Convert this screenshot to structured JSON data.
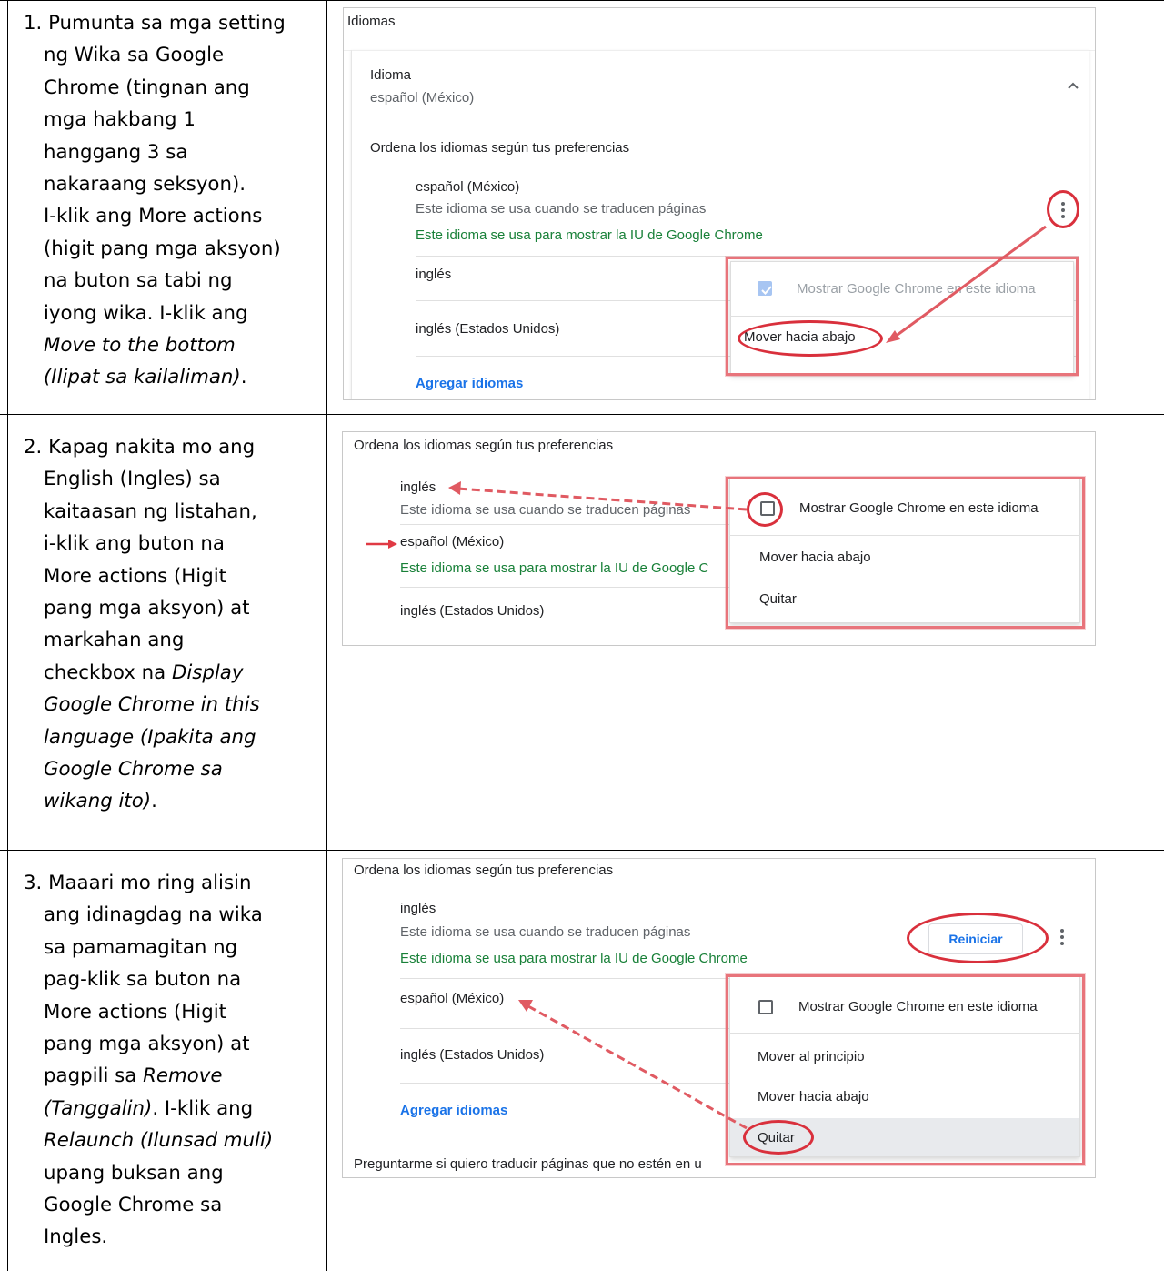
{
  "steps": [
    {
      "text_lines": [
        "1. Pumunta sa mga setting",
        "ng Wika sa Google",
        "Chrome (tingnan ang",
        "mga hakbang 1",
        "hanggang 3 sa",
        "nakaraang seksyon).",
        "I-klik ang More actions",
        "(higit pang mga aksyon)",
        "na buton sa tabi ng",
        "iyong wika. I-klik ang"
      ],
      "italic_lines": [
        "Move to the bottom",
        "(Ilipat sa kailaliman)"
      ],
      "tail": "."
    },
    {
      "text_lines": [
        "2. Kapag nakita mo ang",
        "English (Ingles) sa",
        "kaitaasan ng listahan,",
        "i-klik ang buton na",
        "More actions (Higit",
        "pang mga aksyon) at",
        "markahan ang",
        "checkbox na"
      ],
      "italic_lines": [
        "Display",
        "Google Chrome in this",
        "language (Ipakita ang",
        "Google Chrome sa",
        "wikang ito)"
      ],
      "tail": "."
    },
    {
      "text_lines": [
        "3. Maaari mo ring alisin",
        "ang idinagdag na wika",
        "sa pamamagitan ng",
        "pag-klik sa buton na",
        "More actions (Higit",
        "pang mga aksyon) at",
        "pagpili sa"
      ],
      "italic_a": "Remove",
      "italic_b": "(Tanggalin)",
      "mid": ". I-klik ang",
      "italic_c": "Relaunch (Ilunsad muli)",
      "end_lines": [
        "upang buksan ang",
        "Google Chrome sa",
        "Ingles."
      ]
    }
  ],
  "shot1": {
    "section_title": "Idiomas",
    "idioma_label": "Idioma",
    "idioma_value": "español (México)",
    "order_heading": "Ordena los idiomas según tus preferencias",
    "lang1": "español (México)",
    "lang1_note1": "Este idioma se usa cuando se traducen páginas",
    "lang1_note2": "Este idioma se usa para mostrar la IU de Google Chrome",
    "lang2": "inglés",
    "lang3": "inglés (Estados Unidos)",
    "add": "Agregar idiomas",
    "menu_display": "Mostrar Google Chrome en este idioma",
    "menu_move_down": "Mover hacia abajo"
  },
  "shot2": {
    "order_heading": "Ordena los idiomas según tus preferencias",
    "lang1": "inglés",
    "lang1_note1": "Este idioma se usa cuando se traducen páginas",
    "lang2": "español (México)",
    "lang2_note": "Este idioma se usa para mostrar la IU de Google C",
    "lang3": "inglés (Estados Unidos)",
    "menu_display": "Mostrar Google Chrome en este idioma",
    "menu_move_down": "Mover hacia abajo",
    "menu_remove": "Quitar"
  },
  "shot3": {
    "order_heading": "Ordena los idiomas según tus preferencias",
    "lang1": "inglés",
    "lang1_note1": "Este idioma se usa cuando se traducen páginas",
    "lang1_note2": "Este idioma se usa para mostrar la IU de Google Chrome",
    "relaunch": "Reiniciar",
    "lang2": "español (México)",
    "lang3": "inglés (Estados Unidos)",
    "add": "Agregar idiomas",
    "footer": "Preguntarme si quiero traducir páginas que no estén en u",
    "menu_display": "Mostrar Google Chrome en este idioma",
    "menu_move_top": "Mover al principio",
    "menu_move_down": "Mover hacia abajo",
    "menu_remove": "Quitar"
  }
}
